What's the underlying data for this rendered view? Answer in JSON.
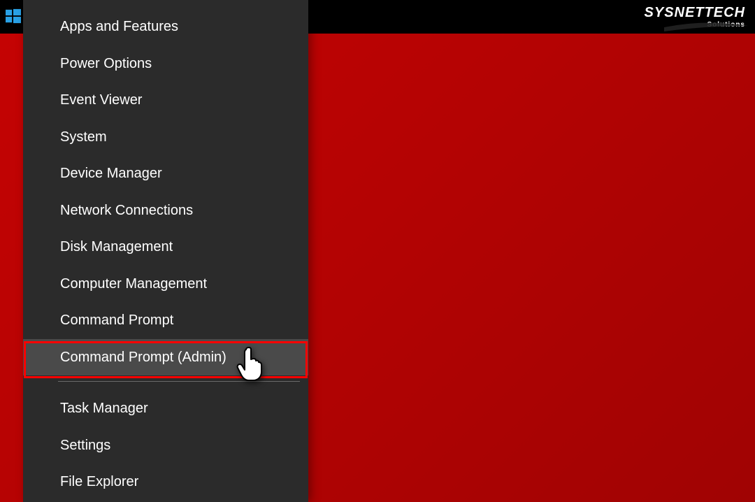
{
  "brand": {
    "name": "SYSNETTECH",
    "tagline": "Solutions"
  },
  "menu": {
    "items": [
      {
        "label": "Apps and Features"
      },
      {
        "label": "Power Options"
      },
      {
        "label": "Event Viewer"
      },
      {
        "label": "System"
      },
      {
        "label": "Device Manager"
      },
      {
        "label": "Network Connections"
      },
      {
        "label": "Disk Management"
      },
      {
        "label": "Computer Management"
      },
      {
        "label": "Command Prompt"
      },
      {
        "label": "Command Prompt (Admin)"
      }
    ],
    "items2": [
      {
        "label": "Task Manager"
      },
      {
        "label": "Settings"
      },
      {
        "label": "File Explorer"
      }
    ]
  }
}
